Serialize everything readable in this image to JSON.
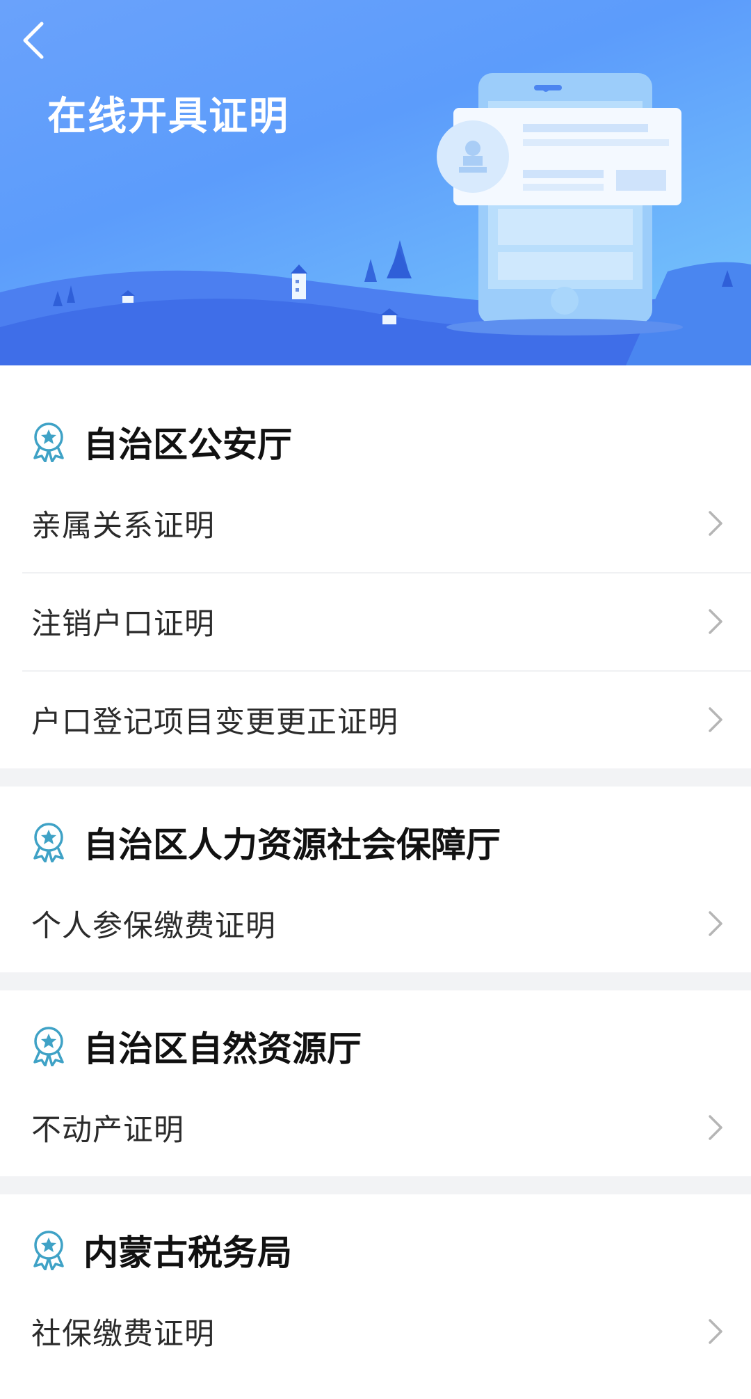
{
  "header": {
    "title": "在线开具证明",
    "back_icon": "chevron-left-icon"
  },
  "sections": [
    {
      "title": "自治区公安厅",
      "icon": "medal-icon",
      "items": [
        {
          "label": "亲属关系证明"
        },
        {
          "label": "注销户口证明"
        },
        {
          "label": "户口登记项目变更更正证明"
        }
      ]
    },
    {
      "title": "自治区人力资源社会保障厅",
      "icon": "medal-icon",
      "items": [
        {
          "label": "个人参保缴费证明"
        }
      ]
    },
    {
      "title": "自治区自然资源厅",
      "icon": "medal-icon",
      "items": [
        {
          "label": "不动产证明"
        }
      ]
    },
    {
      "title": "内蒙古税务局",
      "icon": "medal-icon",
      "items": [
        {
          "label": "社保缴费证明"
        }
      ]
    }
  ],
  "colors": {
    "banner_start": "#6aa2fb",
    "banner_end": "#79c9fb",
    "icon_accent": "#3fa2c6"
  }
}
